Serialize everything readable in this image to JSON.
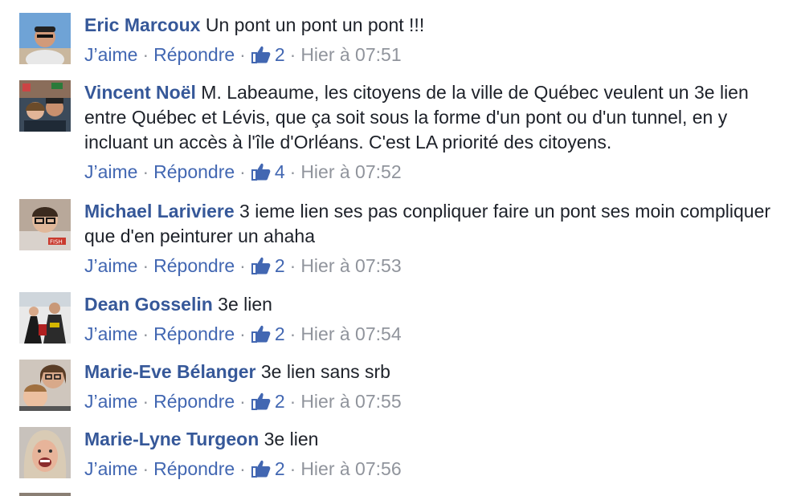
{
  "comments": [
    {
      "author": "Eric Marcoux",
      "text": "Un pont un pont un pont !!!",
      "like": "J’aime",
      "reply": "Répondre",
      "likes": "2",
      "time": "Hier à 07:51"
    },
    {
      "author": "Vincent Noël",
      "text": "M. Labeaume, les citoyens de la ville de Québec veulent un 3e lien entre Québec et Lévis, que ça soit sous la forme d'un pont ou d'un tunnel, en y incluant un accès à l'île d'Orléans. C'est LA priorité des citoyens.",
      "like": "J’aime",
      "reply": "Répondre",
      "likes": "4",
      "time": "Hier à 07:52"
    },
    {
      "author": "Michael Lariviere",
      "text": "3 ieme lien ses pas conpliquer faire un pont ses moin compliquer que d'en peinturer un ahaha",
      "like": "J’aime",
      "reply": "Répondre",
      "likes": "2",
      "time": "Hier à 07:53"
    },
    {
      "author": "Dean Gosselin",
      "text": "3e lien",
      "like": "J’aime",
      "reply": "Répondre",
      "likes": "2",
      "time": "Hier à 07:54"
    },
    {
      "author": "Marie-Eve Bélanger",
      "text": "3e lien sans srb",
      "like": "J’aime",
      "reply": "Répondre",
      "likes": "2",
      "time": "Hier à 07:55"
    },
    {
      "author": "Marie-Lyne Turgeon",
      "text": "3e lien",
      "like": "J’aime",
      "reply": "Répondre",
      "likes": "2",
      "time": "Hier à 07:56"
    }
  ],
  "avatar_sign_text": "FISH",
  "colors": {
    "author": "#365899",
    "link": "#4267b2",
    "meta": "#90949c",
    "text": "#1d2129"
  }
}
